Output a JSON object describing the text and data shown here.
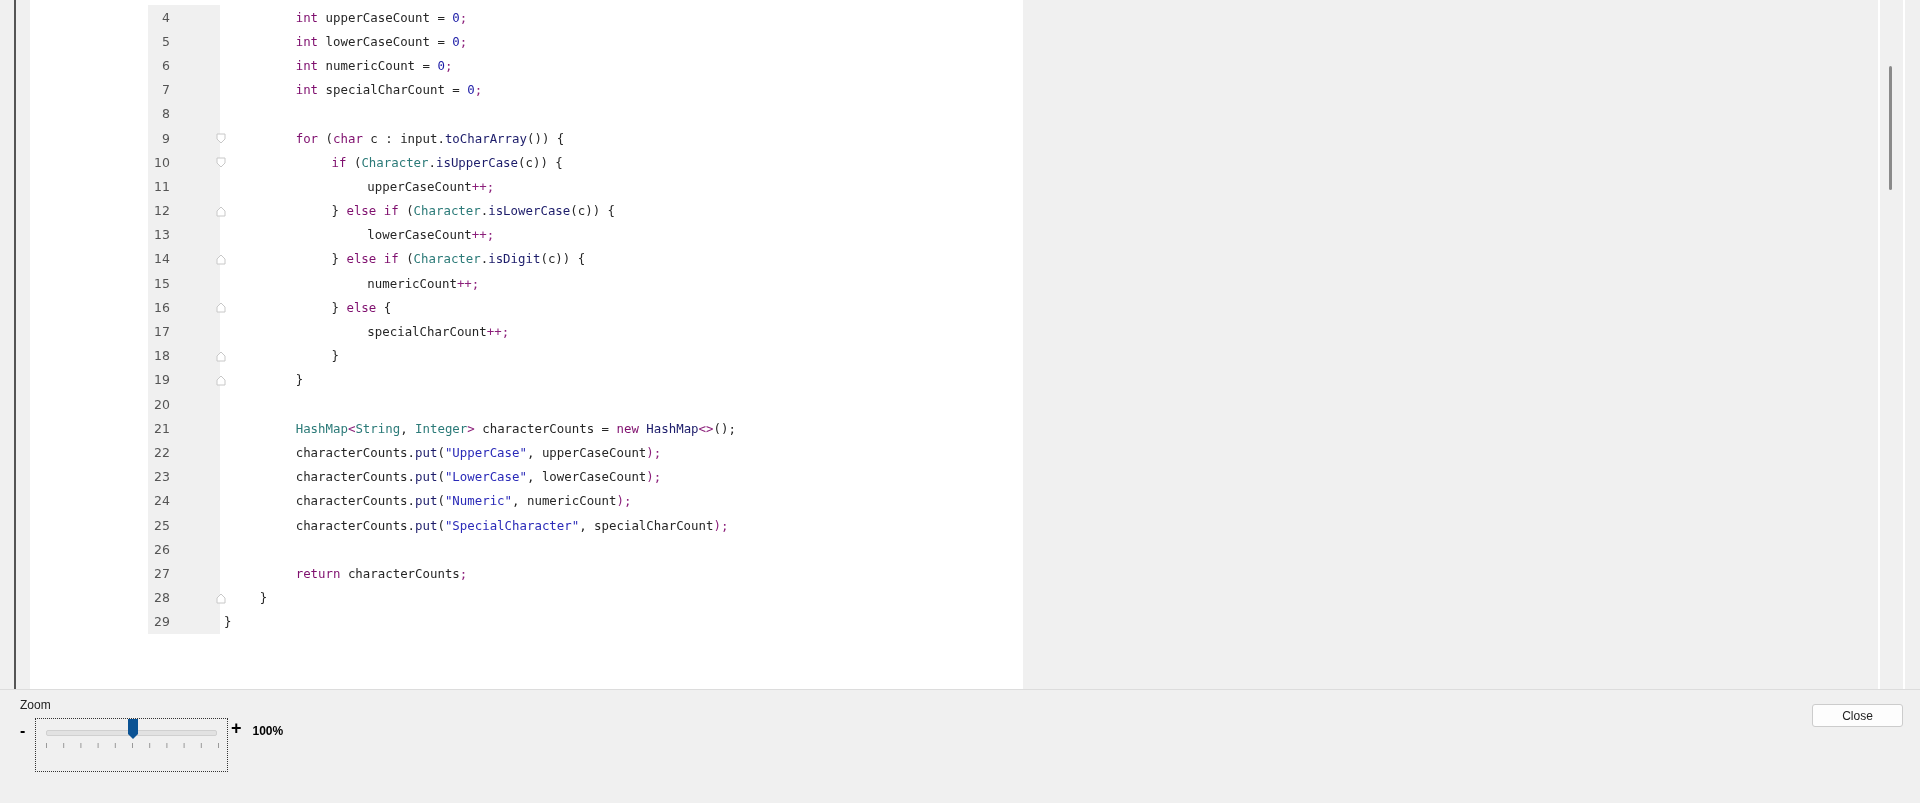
{
  "code": {
    "lines": [
      {
        "number": "4",
        "tokens": [
          {
            "kind": "keyword",
            "text": "        int"
          },
          {
            "kind": "plain",
            "text": " upperCaseCount = "
          },
          {
            "kind": "number",
            "text": "0"
          },
          {
            "kind": "operator",
            "text": ";"
          }
        ]
      },
      {
        "number": "5",
        "tokens": [
          {
            "kind": "keyword",
            "text": "        int"
          },
          {
            "kind": "plain",
            "text": " lowerCaseCount = "
          },
          {
            "kind": "number",
            "text": "0"
          },
          {
            "kind": "operator",
            "text": ";"
          }
        ]
      },
      {
        "number": "6",
        "tokens": [
          {
            "kind": "keyword",
            "text": "        int"
          },
          {
            "kind": "plain",
            "text": " numericCount = "
          },
          {
            "kind": "number",
            "text": "0"
          },
          {
            "kind": "operator",
            "text": ";"
          }
        ]
      },
      {
        "number": "7",
        "tokens": [
          {
            "kind": "keyword",
            "text": "        int"
          },
          {
            "kind": "plain",
            "text": " specialCharCount = "
          },
          {
            "kind": "number",
            "text": "0"
          },
          {
            "kind": "operator",
            "text": ";"
          }
        ]
      },
      {
        "number": "8"
      },
      {
        "number": "9",
        "fold_start": true,
        "tokens": [
          {
            "kind": "keyword",
            "text": "        for"
          },
          {
            "kind": "plain",
            "text": " ("
          },
          {
            "kind": "keyword",
            "text": "char"
          },
          {
            "kind": "plain",
            "text": " c : input."
          },
          {
            "kind": "method",
            "text": "toCharArray"
          },
          {
            "kind": "plain",
            "text": "()) {"
          }
        ]
      },
      {
        "number": "10",
        "fold_start": true,
        "tokens": [
          {
            "kind": "keyword",
            "text": "            if"
          },
          {
            "kind": "plain",
            "text": " ("
          },
          {
            "kind": "type",
            "text": "Character"
          },
          {
            "kind": "plain",
            "text": "."
          },
          {
            "kind": "method",
            "text": "isUpperCase"
          },
          {
            "kind": "plain",
            "text": "(c)) {"
          }
        ]
      },
      {
        "number": "11",
        "tokens": [
          {
            "kind": "plain",
            "text": "                upperCaseCount"
          },
          {
            "kind": "operator",
            "text": "++;"
          }
        ]
      },
      {
        "number": "12",
        "fold_start": false,
        "tokens": [
          {
            "kind": "plain",
            "text": "            } "
          },
          {
            "kind": "keyword",
            "text": "else if"
          },
          {
            "kind": "plain",
            "text": " ("
          },
          {
            "kind": "type",
            "text": "Character"
          },
          {
            "kind": "plain",
            "text": "."
          },
          {
            "kind": "method",
            "text": "isLowerCase"
          },
          {
            "kind": "plain",
            "text": "(c)) {"
          }
        ]
      },
      {
        "number": "13",
        "tokens": [
          {
            "kind": "plain",
            "text": "                lowerCaseCount"
          },
          {
            "kind": "operator",
            "text": "++;"
          }
        ]
      },
      {
        "number": "14",
        "fold_start": false,
        "tokens": [
          {
            "kind": "plain",
            "text": "            } "
          },
          {
            "kind": "keyword",
            "text": "else if"
          },
          {
            "kind": "plain",
            "text": " ("
          },
          {
            "kind": "type",
            "text": "Character"
          },
          {
            "kind": "plain",
            "text": "."
          },
          {
            "kind": "method",
            "text": "isDigit"
          },
          {
            "kind": "plain",
            "text": "(c)) {"
          }
        ]
      },
      {
        "number": "15",
        "tokens": [
          {
            "kind": "plain",
            "text": "                numericCount"
          },
          {
            "kind": "operator",
            "text": "++;"
          }
        ]
      },
      {
        "number": "16",
        "fold_start": false,
        "tokens": [
          {
            "kind": "plain",
            "text": "            } "
          },
          {
            "kind": "keyword",
            "text": "else"
          },
          {
            "kind": "plain",
            "text": " {"
          }
        ]
      },
      {
        "number": "17",
        "tokens": [
          {
            "kind": "plain",
            "text": "                specialCharCount"
          },
          {
            "kind": "operator",
            "text": "++;"
          }
        ]
      },
      {
        "number": "18",
        "fold_start": false,
        "tokens": [
          {
            "kind": "plain",
            "text": "            }"
          }
        ]
      },
      {
        "number": "19",
        "fold_start": false,
        "tokens": [
          {
            "kind": "plain",
            "text": "        }"
          }
        ]
      },
      {
        "number": "20"
      },
      {
        "number": "21",
        "tokens": [
          {
            "kind": "type",
            "text": "        HashMap"
          },
          {
            "kind": "operator",
            "text": "<"
          },
          {
            "kind": "type",
            "text": "String"
          },
          {
            "kind": "plain",
            "text": ", "
          },
          {
            "kind": "type",
            "text": "Integer"
          },
          {
            "kind": "operator",
            "text": ">"
          },
          {
            "kind": "plain",
            "text": " characterCounts = "
          },
          {
            "kind": "keyword",
            "text": "new"
          },
          {
            "kind": "method",
            "text": " HashMap"
          },
          {
            "kind": "operator",
            "text": "<>"
          },
          {
            "kind": "plain",
            "text": "();"
          }
        ]
      },
      {
        "number": "22",
        "tokens": [
          {
            "kind": "plain",
            "text": "        characterCounts."
          },
          {
            "kind": "method",
            "text": "put"
          },
          {
            "kind": "plain",
            "text": "("
          },
          {
            "kind": "string",
            "text": "\"UpperCase\""
          },
          {
            "kind": "plain",
            "text": ", upperCaseCount"
          },
          {
            "kind": "operator",
            "text": ");"
          }
        ]
      },
      {
        "number": "23",
        "tokens": [
          {
            "kind": "plain",
            "text": "        characterCounts."
          },
          {
            "kind": "method",
            "text": "put"
          },
          {
            "kind": "plain",
            "text": "("
          },
          {
            "kind": "string",
            "text": "\"LowerCase\""
          },
          {
            "kind": "plain",
            "text": ", lowerCaseCount"
          },
          {
            "kind": "operator",
            "text": ");"
          }
        ]
      },
      {
        "number": "24",
        "tokens": [
          {
            "kind": "plain",
            "text": "        characterCounts."
          },
          {
            "kind": "method",
            "text": "put"
          },
          {
            "kind": "plain",
            "text": "("
          },
          {
            "kind": "string",
            "text": "\"Numeric\""
          },
          {
            "kind": "plain",
            "text": ", numericCount"
          },
          {
            "kind": "operator",
            "text": ");"
          }
        ]
      },
      {
        "number": "25",
        "tokens": [
          {
            "kind": "plain",
            "text": "        characterCounts."
          },
          {
            "kind": "method",
            "text": "put"
          },
          {
            "kind": "plain",
            "text": "("
          },
          {
            "kind": "string",
            "text": "\"SpecialCharacter\""
          },
          {
            "kind": "plain",
            "text": ", specialCharCount"
          },
          {
            "kind": "operator",
            "text": ");"
          }
        ]
      },
      {
        "number": "26"
      },
      {
        "number": "27",
        "tokens": [
          {
            "kind": "keyword",
            "text": "        return"
          },
          {
            "kind": "plain",
            "text": " characterCounts"
          },
          {
            "kind": "operator",
            "text": ";"
          }
        ]
      },
      {
        "number": "28",
        "fold_start": false,
        "tokens": [
          {
            "kind": "plain",
            "text": "    }"
          }
        ]
      },
      {
        "number": "29",
        "tokens": [
          {
            "kind": "plain",
            "text": "}"
          }
        ]
      }
    ]
  },
  "zoom": {
    "label": "Zoom",
    "minus": "-",
    "plus": "+",
    "level": 0.5,
    "reading": "100%"
  },
  "buttons": [
    {
      "label": "Close"
    }
  ]
}
